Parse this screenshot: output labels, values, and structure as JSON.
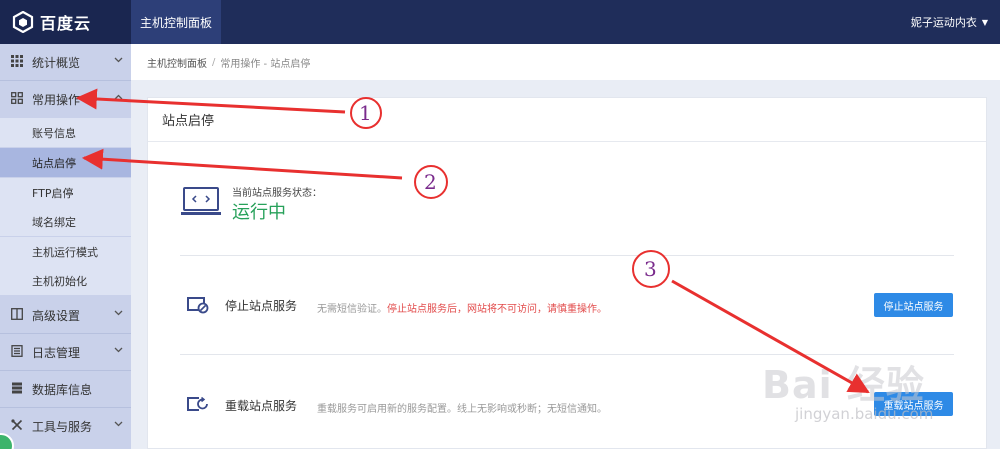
{
  "app": {
    "logo_text": "百度云",
    "top_tab": "主机控制面板",
    "user": "妮子运动内衣",
    "user_caret": "▼"
  },
  "sidebar": {
    "items": [
      {
        "label": "统计概览",
        "icon": "grid-icon"
      },
      {
        "label": "常用操作",
        "icon": "apps-icon"
      },
      {
        "label": "高级设置",
        "icon": "columns-icon"
      },
      {
        "label": "日志管理",
        "icon": "log-icon"
      },
      {
        "label": "数据库信息",
        "icon": "database-icon"
      },
      {
        "label": "工具与服务",
        "icon": "tools-icon"
      }
    ],
    "subitems": [
      {
        "label": "账号信息"
      },
      {
        "label": "站点启停",
        "active": true
      },
      {
        "label": "FTP启停"
      },
      {
        "label": "域名绑定"
      },
      {
        "label": "主机运行模式"
      },
      {
        "label": "主机初始化"
      }
    ]
  },
  "breadcrumb": {
    "root": "主机控制面板",
    "separator": "/",
    "current": "常用操作 - 站点启停"
  },
  "panel": {
    "title": "站点启停",
    "status_label": "当前站点服务状态：",
    "status_value": "运行中",
    "services": [
      {
        "title": "停止站点服务",
        "note_prefix": "无需短信验证。",
        "note_warn": "停止站点服务后，网站将不可访问，请慎重操作。",
        "button": "停止站点服务"
      },
      {
        "title": "重载站点服务",
        "note_prefix": "重载服务可启用新的服务配置。线上无影响或秒断；无短信通知。",
        "note_warn": "",
        "button": "重载站点服务"
      }
    ]
  },
  "annotations": [
    "1",
    "2",
    "3"
  ],
  "watermark": {
    "line1": "Bai 经验",
    "line2": "jingyan.baidu.com"
  },
  "colors": {
    "topbar": "#1f2d5a",
    "sidebar": "#c9d1ea",
    "accent_button": "#2e8ae6",
    "status_green": "#27a15a",
    "warning_red": "#e24b4b",
    "annotation_arrow": "#e8302f",
    "annotation_number": "#7a2b8c"
  }
}
